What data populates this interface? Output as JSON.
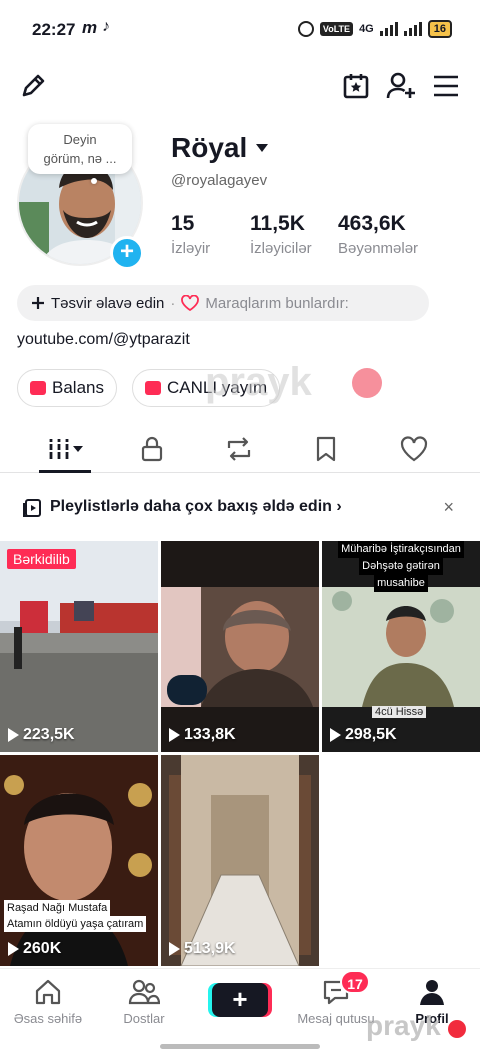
{
  "status_bar": {
    "time": "22:27",
    "notif_m": "m",
    "notif_tiktok": "♪",
    "volte": "VoLTE",
    "network": "4G",
    "battery": "16"
  },
  "profile": {
    "bubble_text_1": "Deyin",
    "bubble_text_2": "görüm, nə ...",
    "username": "Röyal",
    "handle": "@royalagayev",
    "stats": [
      {
        "value": "15",
        "label": "İzləyir"
      },
      {
        "value": "11,5K",
        "label": "İzləyicilər"
      },
      {
        "value": "463,6K",
        "label": "Bəyənmələr"
      }
    ],
    "add_bio_label": "Təsvir əlavə edin",
    "interests_label": "Maraqlarım bunlardır:",
    "link": "youtube.com/@ytparazit",
    "chips": [
      {
        "label": "Balans"
      },
      {
        "label": "CANLI yayım"
      }
    ]
  },
  "promo": {
    "text": "Pleylistlərlə daha çox baxış əldə edin",
    "chevron": "›",
    "close": "×"
  },
  "videos": [
    {
      "views": "223,5K",
      "pinned_label": "Bərkidilib"
    },
    {
      "views": "133,8K"
    },
    {
      "views": "298,5K",
      "caption_lines": [
        "Müharibə İştirakçısından",
        "Dəhşətə gətirən",
        "musahibe"
      ],
      "part_label": "4cü Hissə"
    },
    {
      "views": "260K",
      "caption_lines": [
        "Raşad Nağı Mustafa",
        "Atamın öldüyü yaşa çatıram"
      ]
    },
    {
      "views": "513,9K"
    }
  ],
  "bottom_nav": {
    "items": [
      {
        "label": "Əsas səhifə"
      },
      {
        "label": "Dostlar"
      },
      {
        "label": "Mesaj qutusu"
      },
      {
        "label": "Profil"
      }
    ],
    "create_label": "+",
    "inbox_badge": "17"
  },
  "watermark": "prayk",
  "colors": {
    "accent": "#fe2c55",
    "cyan": "#25f4ee",
    "plus_badge": "#20b3f0",
    "text": "#161823"
  }
}
